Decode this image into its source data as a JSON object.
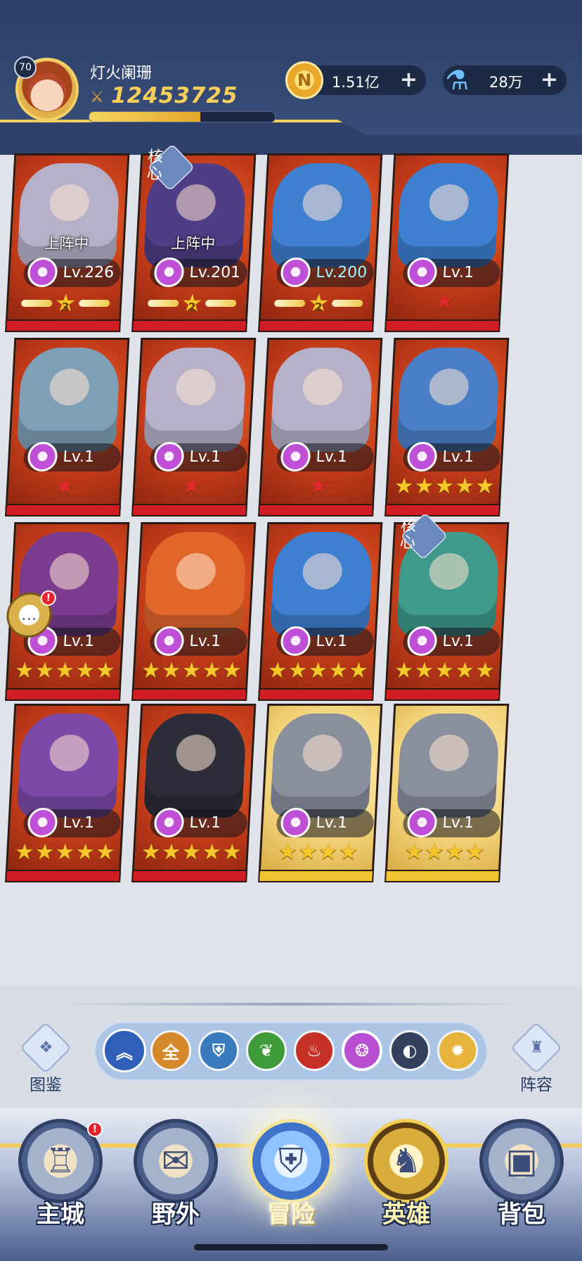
{
  "player": {
    "level": "70",
    "name": "灯火阑珊",
    "power": "12453725",
    "xp_progress": 0.6
  },
  "currencies": {
    "gold": {
      "icon": "coin-icon",
      "value": "1.51亿"
    },
    "potion": {
      "icon": "potion-icon",
      "value": "28万"
    }
  },
  "heroes": [
    {
      "level": "Lv.226",
      "status": "上阵中",
      "art_color": "#b6b0c8",
      "stars": 3,
      "star_style": "wing",
      "core": false
    },
    {
      "level": "Lv.201",
      "status": "上阵中",
      "art_color": "#4f3d86",
      "stars": 2,
      "star_style": "wing",
      "core": true,
      "core_label": "核心"
    },
    {
      "level": "Lv.200",
      "status": "",
      "art_color": "#3e7fd0",
      "stars": 2,
      "star_style": "wing",
      "highlight": true
    },
    {
      "level": "Lv.1",
      "status": "",
      "art_color": "#3e7fd0",
      "stars": 1,
      "star_style": "red"
    },
    {
      "level": "Lv.1",
      "status": "",
      "art_color": "#7f9fb6",
      "stars": 1,
      "star_style": "red"
    },
    {
      "level": "Lv.1",
      "status": "",
      "art_color": "#b6b0c8",
      "stars": 1,
      "star_style": "red"
    },
    {
      "level": "Lv.1",
      "status": "",
      "art_color": "#b6b0c8",
      "stars": 1,
      "star_style": "red"
    },
    {
      "level": "Lv.1",
      "status": "",
      "art_color": "#4a7fc8",
      "stars": 5,
      "star_style": "gold"
    },
    {
      "level": "Lv.1",
      "status": "",
      "art_color": "#7b3b8e",
      "stars": 5,
      "star_style": "gold",
      "chat": true
    },
    {
      "level": "Lv.1",
      "status": "",
      "art_color": "#e0662a",
      "stars": 5,
      "star_style": "gold"
    },
    {
      "level": "Lv.1",
      "status": "",
      "art_color": "#3e7fd0",
      "stars": 5,
      "star_style": "gold"
    },
    {
      "level": "Lv.1",
      "status": "",
      "art_color": "#3f9a8c",
      "stars": 5,
      "star_style": "gold",
      "core": true,
      "core_label": "核心"
    },
    {
      "level": "Lv.1",
      "status": "",
      "art_color": "#7d49a8",
      "stars": 5,
      "star_style": "gold"
    },
    {
      "level": "Lv.1",
      "status": "",
      "art_color": "#2d2d3a",
      "stars": 5,
      "star_style": "gold"
    },
    {
      "level": "Lv.1",
      "status": "",
      "art_color": "#8a8f9e",
      "stars": 4,
      "star_style": "gold",
      "frame": "gold"
    },
    {
      "level": "Lv.1",
      "status": "",
      "art_color": "#8a8f9e",
      "stars": 4,
      "star_style": "gold",
      "frame": "gold"
    }
  ],
  "side_buttons": {
    "codex": {
      "label": "图鉴",
      "icon": "book-icon"
    },
    "lineup": {
      "label": "阵容",
      "icon": "castle-tower-icon"
    }
  },
  "filters": [
    {
      "name": "collapse",
      "icon": "chevron-up-icon",
      "glyph": "︽",
      "color": "#2f5fb8"
    },
    {
      "name": "all",
      "icon": "all-icon",
      "glyph": "全",
      "color": "#d5892a"
    },
    {
      "name": "faction-helm",
      "icon": "helmet-icon",
      "glyph": "⛨",
      "color": "#3a7bbd"
    },
    {
      "name": "faction-tree",
      "icon": "tree-icon",
      "glyph": "❦",
      "color": "#3f9b3a"
    },
    {
      "name": "faction-flame",
      "icon": "flame-icon",
      "glyph": "♨",
      "color": "#c53027"
    },
    {
      "name": "faction-shadow",
      "icon": "shadow-icon",
      "glyph": "❂",
      "color": "#b84fd0"
    },
    {
      "name": "faction-moon",
      "icon": "moon-icon",
      "glyph": "◐",
      "color": "#33405e"
    },
    {
      "name": "faction-sun",
      "icon": "sun-icon",
      "glyph": "✹",
      "color": "#e6b43a"
    }
  ],
  "nav": [
    {
      "label": "主城",
      "icon": "castle-icon",
      "badge": "!"
    },
    {
      "label": "野外",
      "icon": "map-scroll-icon"
    },
    {
      "label": "冒险",
      "icon": "sword-shield-icon",
      "active": true
    },
    {
      "label": "英雄",
      "icon": "knight-helmet-icon",
      "hero": true
    },
    {
      "label": "背包",
      "icon": "backpack-icon"
    }
  ],
  "colors": {
    "header": "#2c3f66",
    "gold_accent": "#f2cf5b",
    "card_red": "#c23b19",
    "bar_red": "#d11d24"
  }
}
